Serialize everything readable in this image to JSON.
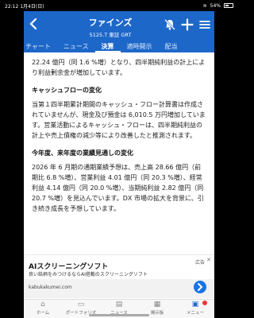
{
  "status_bar": {
    "time": "22:12",
    "date": "1月4日(日)",
    "battery": "54%",
    "battery_level": 0.54
  },
  "header": {
    "back_icon": "chevron-left-icon",
    "title": "ファインズ",
    "subtitle": "5125.T 東証 GRT",
    "icons": [
      "bell-slash-icon",
      "plus-icon",
      "hamburger-menu-icon"
    ]
  },
  "tabs": [
    {
      "label": "チャート",
      "active": false
    },
    {
      "label": "ニュース",
      "active": false
    },
    {
      "label": "決算",
      "active": true
    },
    {
      "label": "適時開示",
      "active": false
    },
    {
      "label": "配当",
      "active": false
    }
  ],
  "content": {
    "para1": "22.24 億円（同 1.6 %増）となり、四半期純利益の計上により利益剰余金が増加しています。",
    "heading2": "キャッシュフローの変化",
    "para2": "当第１四半期累計期間のキャッシュ・フロー計算書は作成されていませんが、現金及び預金は 6,010.5 万円増加しています。営業活動によるキャッシュ・フローは、四半期純利益の計上や売上債権の減少等により改善したと推測されます。",
    "heading3": "今年度、来年度の業績見通しの変化",
    "para3": "2026 年 6 月期の通期業績予想は、売上高 28.66 億円（前期比 6.8 %増）、営業利益 4.01 億円（同 20.3 %増）、経常利益 4.14 億円（同 20.0 %増）、当期純利益 2.82 億円（同 20.7 %増）を見込んでいます。DX 市場の拡大を背景に、引き続き成長を予想しています。"
  },
  "ad": {
    "badge": "広告",
    "close": "✕",
    "title": "AIスクリーニングソフト",
    "description": "良い銘柄をみつけるならAI搭載のスクリーニングソフト",
    "link": "kabukakumei.com",
    "arrow_icon": "chevron-right-icon"
  },
  "nav": [
    {
      "label": "ホーム",
      "icon": "home-icon",
      "glyph": "⌂",
      "active": false
    },
    {
      "label": "ポートフォリオ",
      "icon": "folder-icon",
      "glyph": "▭",
      "active": false
    },
    {
      "label": "ニュース",
      "icon": "news-icon",
      "glyph": "▤",
      "active": false
    },
    {
      "label": "掲示板",
      "icon": "board-icon",
      "glyph": "▦",
      "active": false
    },
    {
      "label": "メニュー",
      "icon": "menu-grid-icon",
      "glyph": "▣",
      "active": true
    }
  ],
  "colors": {
    "header_bg": "#1d67c9",
    "accent": "#1d67c9",
    "notif": "#e53935"
  }
}
